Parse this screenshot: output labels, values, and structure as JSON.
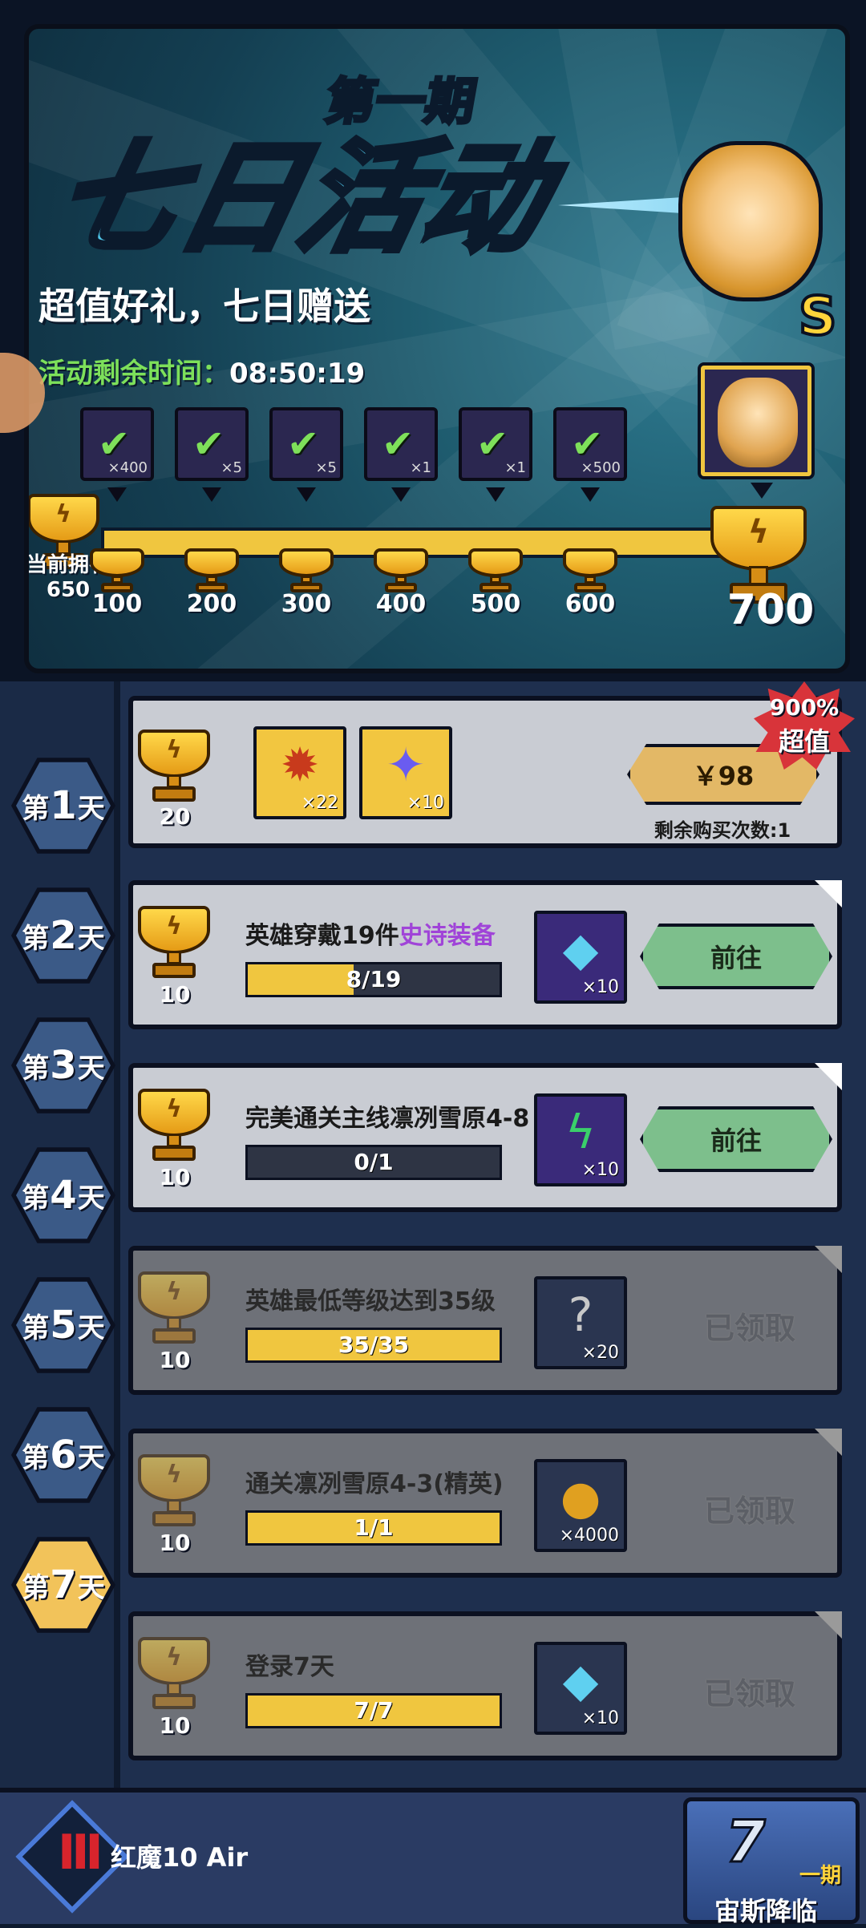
{
  "banner": {
    "period_title": "第一期",
    "event_title": "七日活动",
    "tagline": "超值好礼，七日赠送",
    "timer_label": "活动剩余时间：",
    "timer_value": "08:50:19",
    "hero_grade": "S",
    "owned_label": "当前拥有",
    "owned_value": "650",
    "milestones": [
      {
        "points": "100",
        "qty": "×400",
        "icon": "diamond-icon",
        "claimed": true
      },
      {
        "points": "200",
        "qty": "×5",
        "icon": "equipment-chest-icon",
        "claimed": true
      },
      {
        "points": "300",
        "qty": "×5",
        "icon": "scroll-icon",
        "claimed": true
      },
      {
        "points": "400",
        "qty": "×1",
        "icon": "box-icon",
        "claimed": true
      },
      {
        "points": "500",
        "qty": "×1",
        "icon": "mystery-chest-icon",
        "claimed": true
      },
      {
        "points": "600",
        "qty": "×500",
        "icon": "diamond-icon",
        "claimed": true
      }
    ],
    "final_points": "700"
  },
  "days": [
    {
      "label_pre": "第",
      "num": "1",
      "label_post": "天",
      "active": false
    },
    {
      "label_pre": "第",
      "num": "2",
      "label_post": "天",
      "active": false
    },
    {
      "label_pre": "第",
      "num": "3",
      "label_post": "天",
      "active": false
    },
    {
      "label_pre": "第",
      "num": "4",
      "label_post": "天",
      "active": false
    },
    {
      "label_pre": "第",
      "num": "5",
      "label_post": "天",
      "active": false
    },
    {
      "label_pre": "第",
      "num": "6",
      "label_post": "天",
      "active": false
    },
    {
      "label_pre": "第",
      "num": "7",
      "label_post": "天",
      "active": true
    }
  ],
  "purchase": {
    "points": "20",
    "items": [
      {
        "icon": "rune-chest-icon",
        "qty": "×22"
      },
      {
        "icon": "crystal-icon",
        "qty": "×10"
      }
    ],
    "price": "￥98",
    "remaining": "剩余购买次数:1",
    "badge_line1": "900%",
    "badge_line2": "超值"
  },
  "tasks": [
    {
      "points": "10",
      "title": "英雄穿戴19件",
      "title_highlight": "史诗装备",
      "progress_text": "8/19",
      "progress": 0.42,
      "icon": "diamond-icon",
      "qty": "×10",
      "status": "前往",
      "done": false
    },
    {
      "points": "10",
      "title": "完美通关主线凛冽雪原4-8",
      "title_highlight": "",
      "progress_text": "0/1",
      "progress": 0,
      "icon": "energy-icon",
      "qty": "×10",
      "status": "前往",
      "done": false
    },
    {
      "points": "10",
      "title": "英雄最低等级达到35级",
      "title_highlight": "",
      "progress_text": "35/35",
      "progress": 1,
      "icon": "mystery-chest-icon",
      "qty": "×20",
      "status": "已领取",
      "done": true
    },
    {
      "points": "10",
      "title": "通关凛冽雪原4-3(精英)",
      "title_highlight": "",
      "progress_text": "1/1",
      "progress": 1,
      "icon": "gold-coin-icon",
      "qty": "×4000",
      "status": "已领取",
      "done": true
    },
    {
      "points": "10",
      "title": "登录7天",
      "title_highlight": "",
      "progress_text": "7/7",
      "progress": 1,
      "icon": "diamond-icon",
      "qty": "×10",
      "status": "已领取",
      "done": true
    }
  ],
  "footer": {
    "device_label": "红魔10 Air",
    "event_badge_line1": "一期",
    "event_badge_line2": "宙斯降临"
  },
  "colors": {
    "accent_gold": "#f0c63f",
    "go_button": "#7dbf8c",
    "timer_label": "#7de05a",
    "highlight_purple": "#a044d8"
  }
}
